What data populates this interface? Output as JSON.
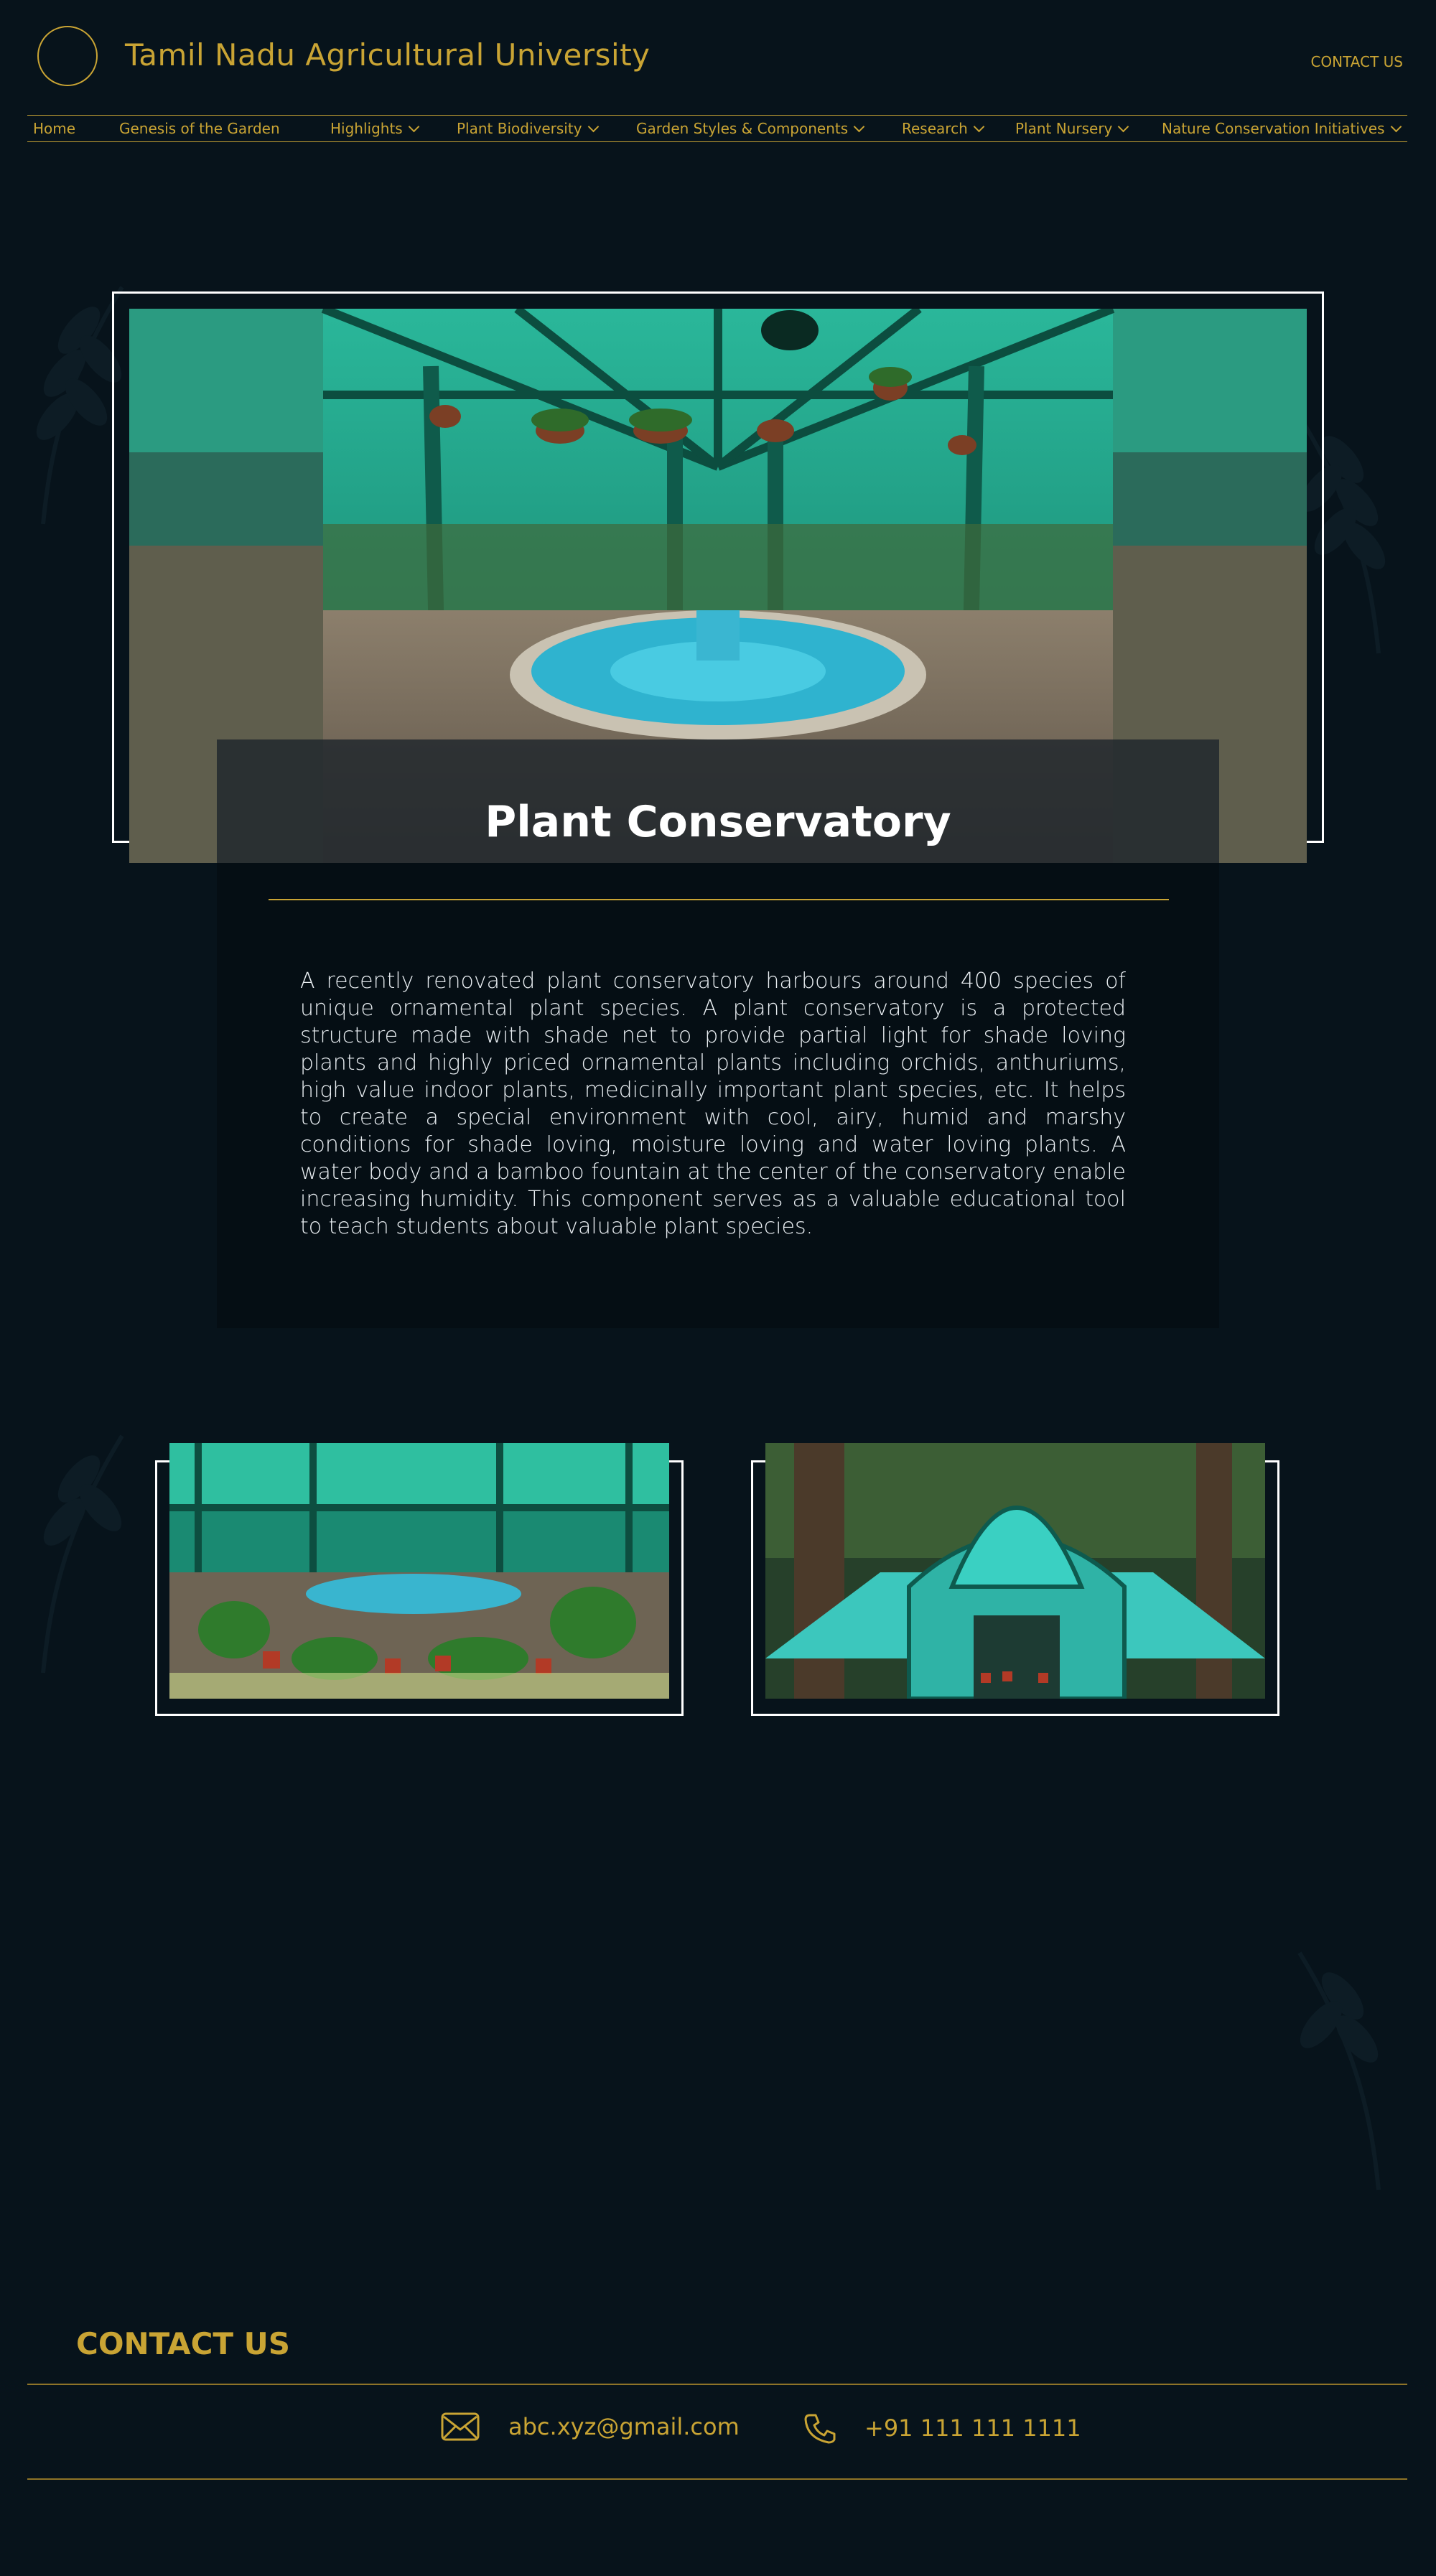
{
  "header": {
    "site_title": "Tamil Nadu Agricultural University",
    "contact_link": "CONTACT US"
  },
  "nav": {
    "items": [
      {
        "label": "Home",
        "has_dropdown": false
      },
      {
        "label": "Genesis of the Garden",
        "has_dropdown": false
      },
      {
        "label": "Highlights",
        "has_dropdown": true
      },
      {
        "label": "Plant Biodiversity",
        "has_dropdown": true
      },
      {
        "label": "Garden Styles & Components",
        "has_dropdown": true
      },
      {
        "label": "Research",
        "has_dropdown": true
      },
      {
        "label": "Plant Nursery",
        "has_dropdown": true
      },
      {
        "label": "Nature Conservation Initiatives",
        "has_dropdown": true
      }
    ]
  },
  "main": {
    "title": "Plant Conservatory",
    "description": "A recently renovated plant conservatory harbours around 400 species of unique ornamental plant species. A plant conservatory is a protected structure made with shade net to provide partial light for shade loving plants and highly priced ornamental plants including orchids, anthuriums, high value indoor plants, medicinally important plant species, etc. It helps to create a special environment with cool, airy, humid and marshy conditions for shade loving, moisture loving and water loving plants. A water body and a bamboo fountain at the center of the conservatory enable increasing humidity.  This component serves as a valuable educational tool to teach students about valuable plant species."
  },
  "footer": {
    "title": "CONTACT US",
    "email": "abc.xyz@gmail.com",
    "phone": "+91 111 111 1111"
  },
  "colors": {
    "background": "#07131b",
    "accent_gold": "#c9a434",
    "panel": "#050e14",
    "greenhouse_teal": "#1f8f78"
  }
}
